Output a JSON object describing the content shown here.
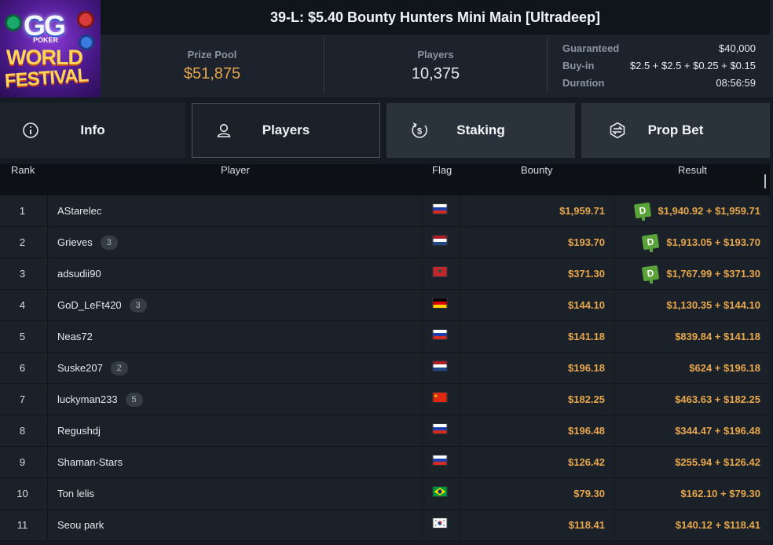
{
  "header": {
    "logo_text": [
      "GG",
      "POKER",
      "WORLD",
      "FESTIVAL"
    ],
    "title": "39-L: $5.40 Bounty Hunters Mini Main [Ultradeep]",
    "prize_pool": {
      "label": "Prize Pool",
      "value": "$51,875"
    },
    "players": {
      "label": "Players",
      "value": "10,375"
    },
    "details": [
      {
        "key": "Guaranteed",
        "value": "$40,000"
      },
      {
        "key": "Buy-in",
        "value": "$2.5 + $2.5 + $0.25 + $0.15"
      },
      {
        "key": "Duration",
        "value": "08:56:59"
      }
    ]
  },
  "tabs": [
    {
      "label": "Info",
      "icon": "info-icon",
      "active": false
    },
    {
      "label": "Players",
      "icon": "user-icon",
      "active": true
    },
    {
      "label": "Staking",
      "icon": "staking-coin-icon",
      "active": false
    },
    {
      "label": "Prop Bet",
      "icon": "prop-bet-icon",
      "active": false
    }
  ],
  "table": {
    "columns": [
      "Rank",
      "Player",
      "Flag",
      "Bounty",
      "Result"
    ],
    "rows": [
      {
        "rank": "1",
        "player": "AStarelec",
        "badge": "",
        "flag": "russia",
        "bounty": "$1,959.71",
        "result": "$1,940.92 + $1,959.71",
        "d": true
      },
      {
        "rank": "2",
        "player": "Grieves",
        "badge": "3",
        "flag": "netherlands",
        "bounty": "$193.70",
        "result": "$1,913.05 + $193.70",
        "d": true
      },
      {
        "rank": "3",
        "player": "adsudii90",
        "badge": "",
        "flag": "morocco",
        "bounty": "$371.30",
        "result": "$1,767.99 + $371.30",
        "d": true
      },
      {
        "rank": "4",
        "player": "GoD_LeFt420",
        "badge": "3",
        "flag": "germany",
        "bounty": "$144.10",
        "result": "$1,130.35 + $144.10",
        "d": false
      },
      {
        "rank": "5",
        "player": "Neas72",
        "badge": "",
        "flag": "russia",
        "bounty": "$141.18",
        "result": "$839.84 + $141.18",
        "d": false
      },
      {
        "rank": "6",
        "player": "Suske207",
        "badge": "2",
        "flag": "netherlands",
        "bounty": "$196.18",
        "result": "$624 + $196.18",
        "d": false
      },
      {
        "rank": "7",
        "player": "luckyman233",
        "badge": "5",
        "flag": "china",
        "bounty": "$182.25",
        "result": "$463.63 + $182.25",
        "d": false
      },
      {
        "rank": "8",
        "player": "Regushdj",
        "badge": "",
        "flag": "russia",
        "bounty": "$196.48",
        "result": "$344.47 + $196.48",
        "d": false
      },
      {
        "rank": "9",
        "player": "Shaman-Stars",
        "badge": "",
        "flag": "russia",
        "bounty": "$126.42",
        "result": "$255.94 + $126.42",
        "d": false
      },
      {
        "rank": "10",
        "player": "Ton lelis",
        "badge": "",
        "flag": "brazil",
        "bounty": "$79.30",
        "result": "$162.10 + $79.30",
        "d": false
      },
      {
        "rank": "11",
        "player": "Seou park",
        "badge": "",
        "flag": "south-korea",
        "bounty": "$118.41",
        "result": "$140.12 + $118.41",
        "d": false
      }
    ]
  },
  "colors": {
    "accent_gold": "#e8a64b",
    "deal_green": "#5aa33a",
    "panel": "#1c232c",
    "tab_active": "#1a2129"
  }
}
